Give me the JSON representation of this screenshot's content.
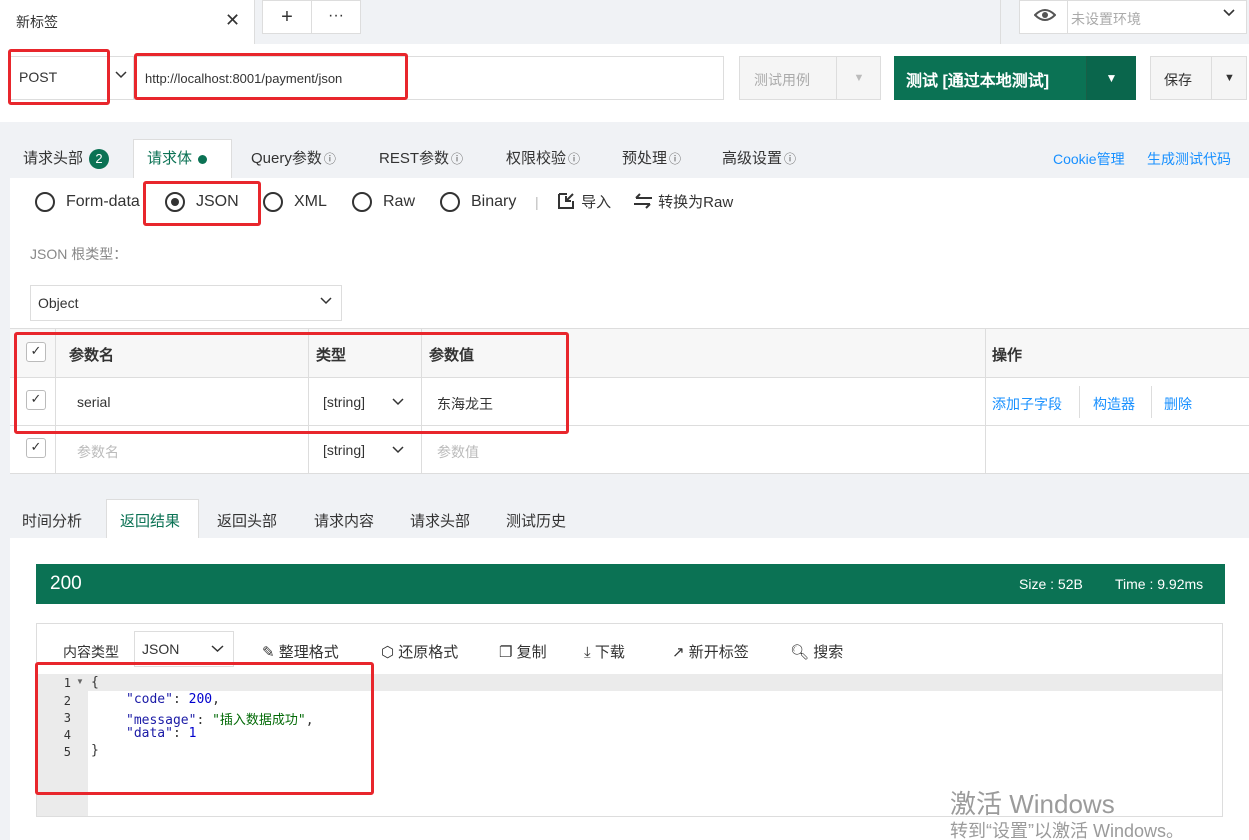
{
  "tab": {
    "title": "新标签",
    "close": "✕",
    "add": "+",
    "more": "···"
  },
  "env": {
    "placeholder": "未设置环境"
  },
  "request": {
    "method": "POST",
    "url": "http://localhost:8001/payment/json",
    "testcase_label": "测试用例",
    "run_label": "测试 [通过本地测试]",
    "save_label": "保存"
  },
  "req_tabs": {
    "headers": "请求头部",
    "headers_count": "2",
    "body": "请求体",
    "query": "Query参数",
    "rest": "REST参数",
    "auth": "权限校验",
    "pre": "预处理",
    "advanced": "高级设置",
    "cookie": "Cookie管理",
    "gen_code": "生成测试代码"
  },
  "body_types": [
    "Form-data",
    "JSON",
    "XML",
    "Raw",
    "Binary"
  ],
  "body_actions": {
    "import": "导入",
    "to_raw": "转换为Raw",
    "separator": "|"
  },
  "root_type": {
    "label": "JSON 根类型：",
    "value": "Object"
  },
  "table": {
    "headers": {
      "name": "参数名",
      "type": "类型",
      "value": "参数值",
      "ops": "操作"
    },
    "rows": [
      {
        "name": "serial",
        "type": "[string]",
        "value": "东海龙王"
      }
    ],
    "placeholder": {
      "name": "参数名",
      "type": "[string]",
      "value": "参数值"
    },
    "ops": {
      "add_child": "添加子字段",
      "builder": "构造器",
      "delete": "删除"
    }
  },
  "res_tabs": [
    "时间分析",
    "返回结果",
    "返回头部",
    "请求内容",
    "请求头部",
    "测试历史"
  ],
  "response": {
    "status": "200",
    "size": "Size : 52B",
    "time": "Time : 9.92ms",
    "content_type_label": "内容类型",
    "content_type_value": "JSON",
    "tools": {
      "format": "整理格式",
      "restore": "还原格式",
      "copy": "复制",
      "download": "下载",
      "new_tab": "新开标签",
      "search": "搜索"
    },
    "line_numbers": [
      "1",
      "2",
      "3",
      "4",
      "5"
    ],
    "code": {
      "open": "{",
      "code_key": "\"code\"",
      "code_val": "200",
      "message_key": "\"message\"",
      "message_val": "\"插入数据成功\"",
      "data_key": "\"data\"",
      "data_val": "1",
      "close": "}"
    }
  },
  "watermark": {
    "line1": "激活 Windows",
    "line2": "转到“设置”以激活 Windows。"
  },
  "colors": {
    "accent": "#0b7254",
    "link": "#1890ff",
    "highlight": "#e8262c"
  }
}
